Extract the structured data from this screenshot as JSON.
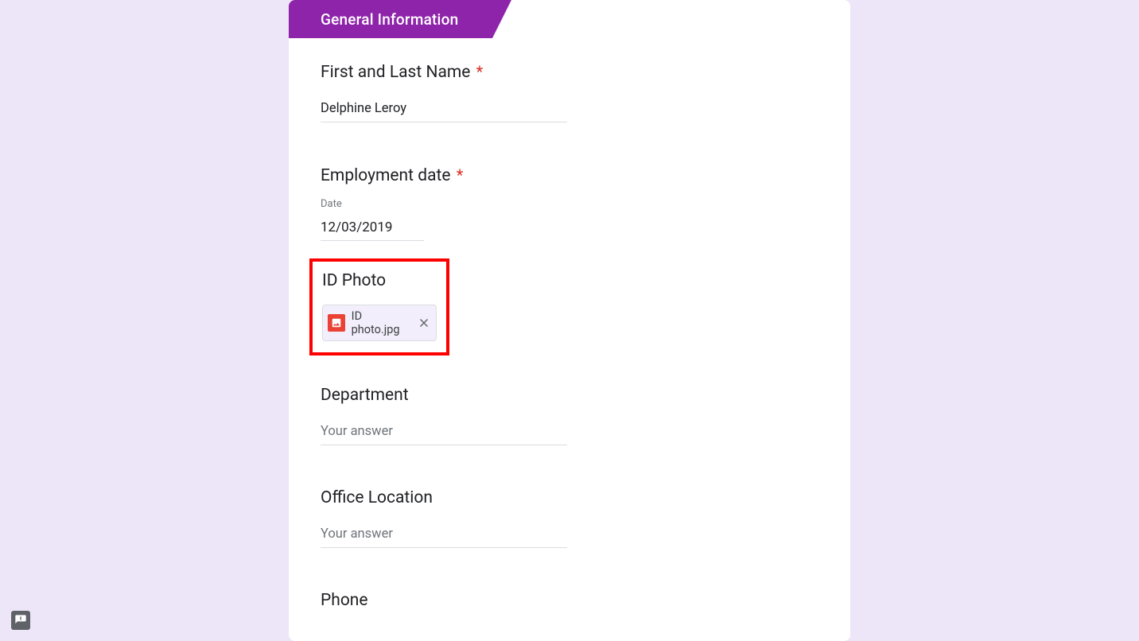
{
  "section": {
    "title": "General Information"
  },
  "questions": {
    "name": {
      "label": "First and Last Name",
      "required": "*",
      "value": "Delphine Leroy"
    },
    "employment_date": {
      "label": "Employment date",
      "required": "*",
      "sublabel": "Date",
      "value": "12/03/2019"
    },
    "id_photo": {
      "label": "ID Photo",
      "file_name": "ID photo.jpg"
    },
    "department": {
      "label": "Department",
      "placeholder": "Your answer"
    },
    "office_location": {
      "label": "Office Location",
      "placeholder": "Your answer"
    },
    "phone": {
      "label": "Phone"
    }
  }
}
